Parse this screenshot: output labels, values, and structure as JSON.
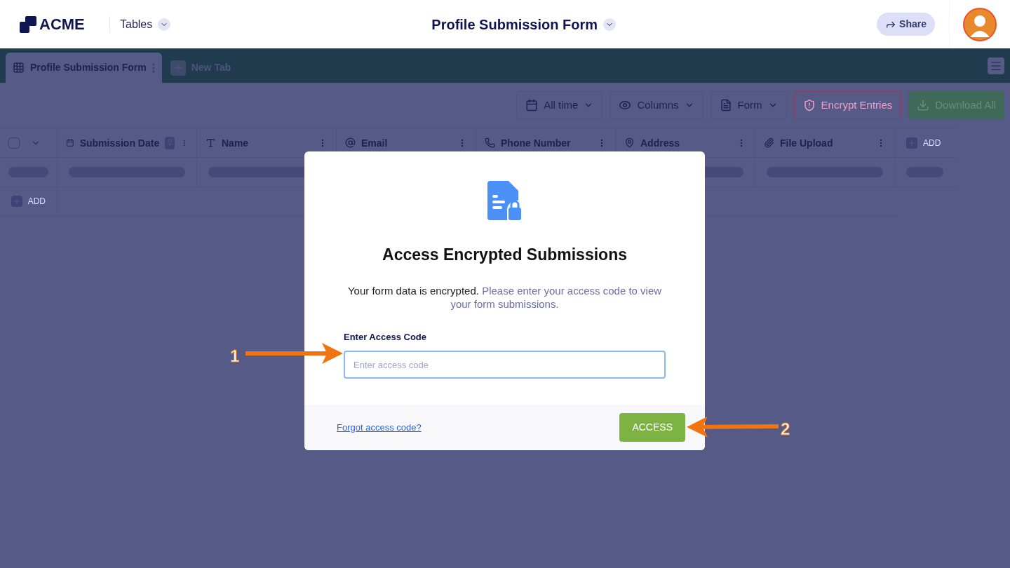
{
  "header": {
    "logo": "ACME",
    "app_menu": "Tables",
    "title": "Profile Submission Form",
    "share": "Share"
  },
  "tabs": [
    {
      "label": "Profile Submission Form",
      "selected": true
    },
    {
      "label": "New Tab",
      "selected": false
    }
  ],
  "toolbar": [
    {
      "kind": "date",
      "label": "All time"
    },
    {
      "kind": "columns",
      "label": "Columns"
    },
    {
      "kind": "form",
      "label": "Form"
    },
    {
      "kind": "encrypt",
      "label": "Encrypt Entries"
    },
    {
      "kind": "download",
      "label": "Download All"
    }
  ],
  "table": {
    "columns": [
      {
        "kind": "date",
        "name": "Submission Date",
        "pinned": true
      },
      {
        "kind": "text",
        "name": "Name",
        "pinned": false
      },
      {
        "kind": "email",
        "name": "Email",
        "pinned": false
      },
      {
        "kind": "phone",
        "name": "Phone Number",
        "pinned": false
      },
      {
        "kind": "address",
        "name": "Address",
        "pinned": false
      },
      {
        "kind": "file",
        "name": "File Upload",
        "pinned": false
      }
    ],
    "select_all": {
      "checked": false
    },
    "add_column": "ADD",
    "add_row": "ADD"
  },
  "dialog": {
    "title": "Access Encrypted Submissions",
    "message": "Your form data is encrypted.",
    "message_hint": "Please enter your access code to view your form submissions.",
    "field_label": "Enter Access Code",
    "placeholder": "Enter access code",
    "forgot_link": "Forgot access code?",
    "submit": "ACCESS"
  },
  "annotations": [
    {
      "label": "1"
    },
    {
      "label": "2"
    }
  ]
}
